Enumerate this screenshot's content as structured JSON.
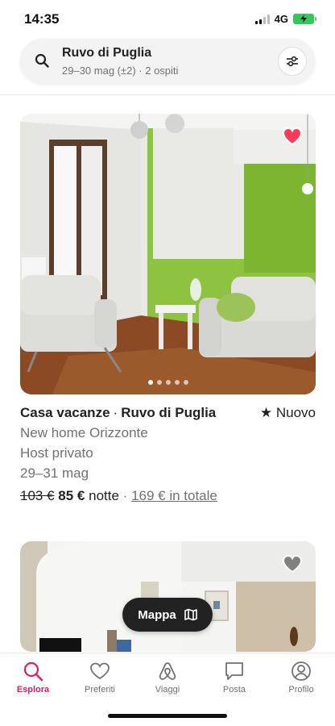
{
  "status": {
    "time": "14:35",
    "network": "4G"
  },
  "search": {
    "title": "Ruvo di Puglia",
    "subtitle": "29–30 mag (±2) · 2 ospiti"
  },
  "listings": [
    {
      "category": "Casa vacanze",
      "location": "Ruvo di Puglia",
      "rating_label": "Nuovo",
      "name": "New home Orizzonte",
      "host": "Host privato",
      "dates": "29–31 mag",
      "price_old": "103 €",
      "price_new": "85 €",
      "price_unit": "notte",
      "price_total": "169 € in totale",
      "favorited": true,
      "photo_count": 5,
      "active_photo": 1
    },
    {
      "favorited": false
    }
  ],
  "map_button": {
    "label": "Mappa"
  },
  "nav": {
    "items": [
      {
        "label": "Esplora",
        "icon": "search-icon",
        "active": true
      },
      {
        "label": "Preferiti",
        "icon": "heart-icon",
        "active": false
      },
      {
        "label": "Viaggi",
        "icon": "airbnb-logo-icon",
        "active": false
      },
      {
        "label": "Posta",
        "icon": "chat-icon",
        "active": false
      },
      {
        "label": "Profilo",
        "icon": "profile-icon",
        "active": false
      }
    ]
  },
  "colors": {
    "accent": "#e31c5f",
    "heart_fill": "#ff385c",
    "text_primary": "#222222",
    "text_secondary": "#717171"
  }
}
